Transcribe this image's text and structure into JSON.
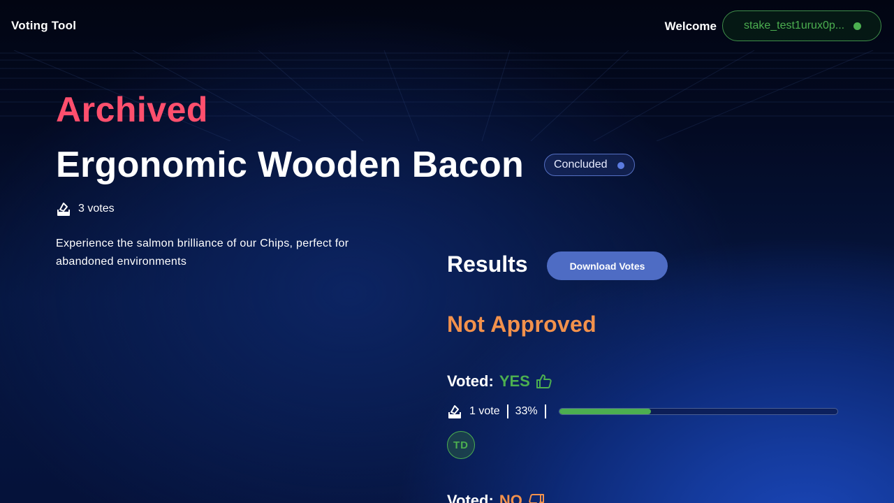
{
  "header": {
    "brand": "Voting Tool",
    "welcome": "Welcome",
    "wallet_address": "stake_test1urux0p..."
  },
  "proposal": {
    "state": "Archived",
    "title": "Ergonomic Wooden Bacon",
    "status_badge": "Concluded",
    "vote_count": "3 votes",
    "description": "Experience the salmon brilliance of our Chips, perfect for abandoned environments"
  },
  "results": {
    "heading": "Results",
    "download_label": "Download Votes",
    "outcome": "Not Approved",
    "options": [
      {
        "label": "Voted:",
        "choice": "YES",
        "icon": "thumbs-up-icon",
        "votes": "1 vote",
        "percent": "33%",
        "fraction": 0.33,
        "voters": [
          "TD"
        ]
      },
      {
        "label": "Voted:",
        "choice": "NO",
        "icon": "thumbs-down-icon"
      }
    ]
  },
  "colors": {
    "archived": "#ff4f6d",
    "yes": "#4caf50",
    "no": "#f2914c",
    "accent": "#4e6cc4"
  }
}
